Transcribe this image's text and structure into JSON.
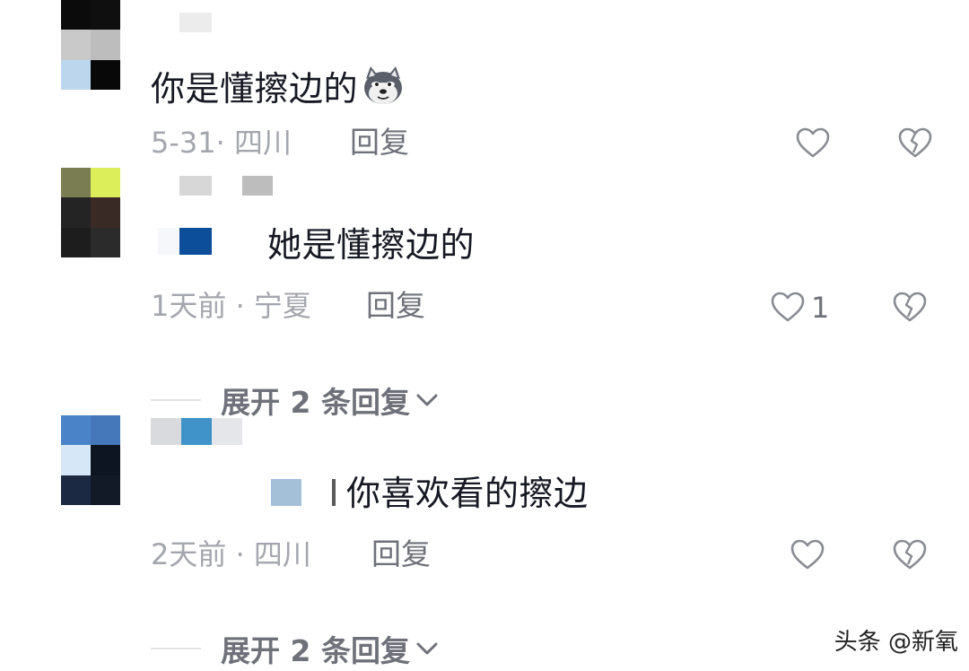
{
  "comments": [
    {
      "text": "你是懂擦边的",
      "emoji": "husky-dog-emoji",
      "date_location": "5-31· 四川",
      "reply_label": "回复",
      "like_count": ""
    },
    {
      "text": "她是懂擦边的",
      "date_location": "1天前 · 宁夏",
      "reply_label": "回复",
      "like_count": "1",
      "expand_label": "展开 2 条回复"
    },
    {
      "text": "你喜欢看的擦边",
      "date_location": "2天前 · 四川",
      "reply_label": "回复",
      "like_count": "",
      "expand_label": "展开 2 条回复"
    }
  ],
  "watermark": "头条 @新氧",
  "colors": {
    "text": "#161823",
    "meta": "#a4a6ad",
    "secondary": "#6f717a"
  },
  "icons": {
    "like": "heart-outline-icon",
    "dislike": "broken-heart-icon",
    "expand": "chevron-down-icon"
  }
}
